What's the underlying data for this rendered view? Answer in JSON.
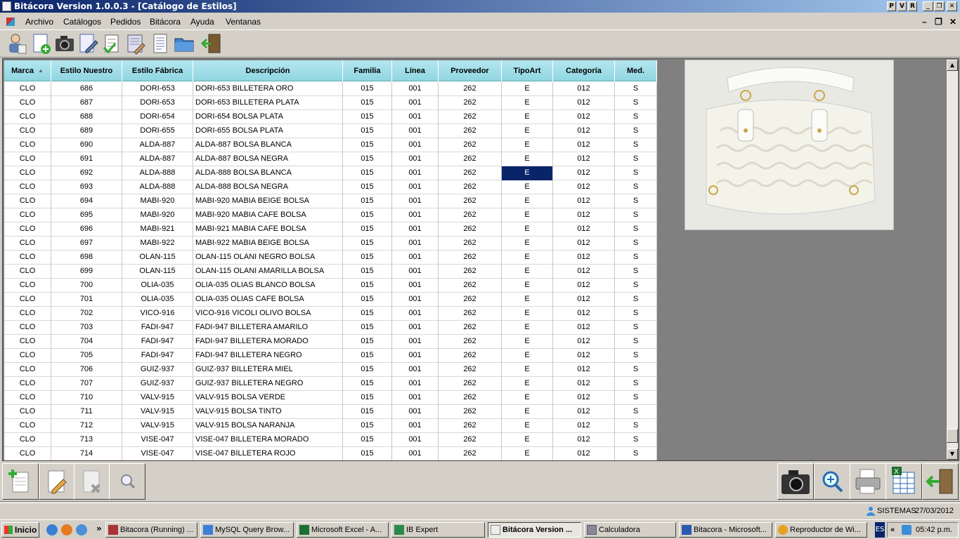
{
  "window": {
    "title": "Bitácora Version 1.0.0.3 - [Catálogo de Estilos]",
    "title_buttons": [
      "P",
      "V",
      "R"
    ]
  },
  "menu": [
    "Archivo",
    "Catálogos",
    "Pedidos",
    "Bitácora",
    "Ayuda",
    "Ventanas"
  ],
  "toolbar_icons": [
    "user-icon",
    "new-document-icon",
    "camera-icon",
    "edit-document-icon",
    "checklist-icon",
    "book-edit-icon",
    "list-document-icon",
    "folder-icon",
    "exit-door-icon"
  ],
  "grid": {
    "headers": {
      "marca": "Marca",
      "estilo_nuestro": "Estilo Nuestro",
      "estilo_fabrica": "Estilo Fábrica",
      "descripcion": "Descripción",
      "familia": "Familia",
      "linea": "Línea",
      "proveedor": "Proveedor",
      "tipoart": "TipoArt",
      "categoria": "Categoría",
      "med": "Med."
    },
    "rows": [
      [
        "CLO",
        "686",
        "DORI-653",
        "DORI-653 BILLETERA ORO",
        "015",
        "001",
        "262",
        "E",
        "012",
        "S"
      ],
      [
        "CLO",
        "687",
        "DORI-653",
        "DORI-653 BILLETERA PLATA",
        "015",
        "001",
        "262",
        "E",
        "012",
        "S"
      ],
      [
        "CLO",
        "688",
        "DORI-654",
        "DORI-654 BOLSA PLATA",
        "015",
        "001",
        "262",
        "E",
        "012",
        "S"
      ],
      [
        "CLO",
        "689",
        "DORI-655",
        "DORI-655 BOLSA PLATA",
        "015",
        "001",
        "262",
        "E",
        "012",
        "S"
      ],
      [
        "CLO",
        "690",
        "ALDA-887",
        "ALDA-887 BOLSA BLANCA",
        "015",
        "001",
        "262",
        "E",
        "012",
        "S"
      ],
      [
        "CLO",
        "691",
        "ALDA-887",
        "ALDA-887 BOLSA NEGRA",
        "015",
        "001",
        "262",
        "E",
        "012",
        "S"
      ],
      [
        "CLO",
        "692",
        "ALDA-888",
        "ALDA-888 BOLSA BLANCA",
        "015",
        "001",
        "262",
        "E",
        "012",
        "S"
      ],
      [
        "CLO",
        "693",
        "ALDA-888",
        "ALDA-888 BOLSA NEGRA",
        "015",
        "001",
        "262",
        "E",
        "012",
        "S"
      ],
      [
        "CLO",
        "694",
        "MABI-920",
        "MABI-920 MABIA BEIGE BOLSA",
        "015",
        "001",
        "262",
        "E",
        "012",
        "S"
      ],
      [
        "CLO",
        "695",
        "MABI-920",
        "MABI-920 MABIA CAFE BOLSA",
        "015",
        "001",
        "262",
        "E",
        "012",
        "S"
      ],
      [
        "CLO",
        "696",
        "MABI-921",
        "MABI-921 MABIA CAFE BOLSA",
        "015",
        "001",
        "262",
        "E",
        "012",
        "S"
      ],
      [
        "CLO",
        "697",
        "MABI-922",
        "MABI-922 MABIA BEIGE BOLSA",
        "015",
        "001",
        "262",
        "E",
        "012",
        "S"
      ],
      [
        "CLO",
        "698",
        "OLAN-115",
        "OLAN-115 OLANI NEGRO BOLSA",
        "015",
        "001",
        "262",
        "E",
        "012",
        "S"
      ],
      [
        "CLO",
        "699",
        "OLAN-115",
        "OLAN-115 OLANI AMARILLA BOLSA",
        "015",
        "001",
        "262",
        "E",
        "012",
        "S"
      ],
      [
        "CLO",
        "700",
        "OLIA-035",
        "OLIA-035 OLIAS BLANCO BOLSA",
        "015",
        "001",
        "262",
        "E",
        "012",
        "S"
      ],
      [
        "CLO",
        "701",
        "OLIA-035",
        "OLIA-035 OLIAS CAFE BOLSA",
        "015",
        "001",
        "262",
        "E",
        "012",
        "S"
      ],
      [
        "CLO",
        "702",
        "VICO-916",
        "VICO-916 VICOLI OLIVO BOLSA",
        "015",
        "001",
        "262",
        "E",
        "012",
        "S"
      ],
      [
        "CLO",
        "703",
        "FADI-947",
        "FADI-947 BILLETERA AMARILO",
        "015",
        "001",
        "262",
        "E",
        "012",
        "S"
      ],
      [
        "CLO",
        "704",
        "FADI-947",
        "FADI-947 BILLETERA MORADO",
        "015",
        "001",
        "262",
        "E",
        "012",
        "S"
      ],
      [
        "CLO",
        "705",
        "FADI-947",
        "FADI-947 BILLETERA NEGRO",
        "015",
        "001",
        "262",
        "E",
        "012",
        "S"
      ],
      [
        "CLO",
        "706",
        "GUIZ-937",
        "GUIZ-937 BILLETERA MIEL",
        "015",
        "001",
        "262",
        "E",
        "012",
        "S"
      ],
      [
        "CLO",
        "707",
        "GUIZ-937",
        "GUIZ-937 BILLETERA NEGRO",
        "015",
        "001",
        "262",
        "E",
        "012",
        "S"
      ],
      [
        "CLO",
        "710",
        "VALV-915",
        "VALV-915 BOLSA VERDE",
        "015",
        "001",
        "262",
        "E",
        "012",
        "S"
      ],
      [
        "CLO",
        "711",
        "VALV-915",
        "VALV-915 BOLSA TINTO",
        "015",
        "001",
        "262",
        "E",
        "012",
        "S"
      ],
      [
        "CLO",
        "712",
        "VALV-915",
        "VALV-915 BOLSA NARANJA",
        "015",
        "001",
        "262",
        "E",
        "012",
        "S"
      ],
      [
        "CLO",
        "713",
        "VISE-047",
        "VISE-047 BILLETERA MORADO",
        "015",
        "001",
        "262",
        "E",
        "012",
        "S"
      ],
      [
        "CLO",
        "714",
        "VISE-047",
        "VISE-047 BILLETERA ROJO",
        "015",
        "001",
        "262",
        "E",
        "012",
        "S"
      ]
    ],
    "selected_row": 6,
    "selected_col": 7,
    "sort_column": "marca",
    "sort_direction": "ascending"
  },
  "bottom_buttons": {
    "left": [
      "add-document-icon",
      "edit-icon",
      "delete-icon",
      "search-icon"
    ],
    "right": [
      "camera-icon",
      "zoom-icon",
      "print-icon",
      "excel-export-icon",
      "exit-icon"
    ]
  },
  "status": {
    "user": "SISTEMAS",
    "date": "27/03/2012"
  },
  "taskbar": {
    "start_label": "Inicio",
    "tasks": [
      "Bitacora (Running) ...",
      "MySQL Query Brow...",
      "Microsoft Excel - A...",
      "IB Expert",
      "Bitácora Version ...",
      "Calculadora",
      "Bitacora - Microsoft...",
      "Reproductor de Wi..."
    ],
    "active_task": 4,
    "language": "ES",
    "clock": "05:42 p.m.",
    "expand_label": "«",
    "quicklaunch_more": "»"
  },
  "colors": {
    "header": "#9fdce6",
    "selection": "#0a246a",
    "titlebar": "#0a246a"
  }
}
